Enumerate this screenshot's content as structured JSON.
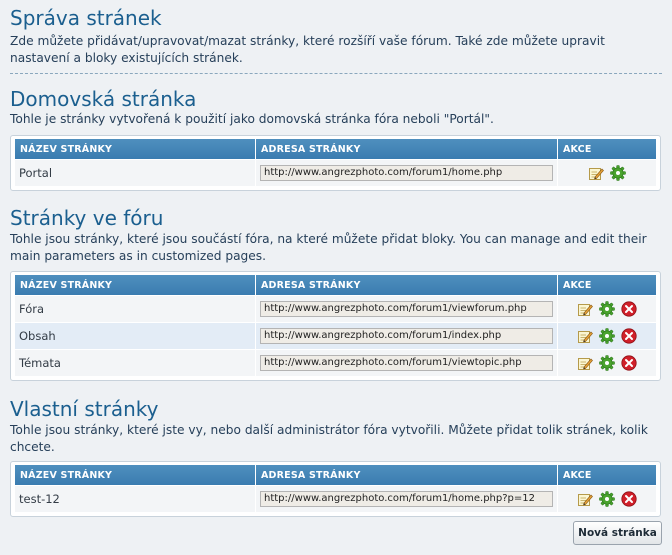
{
  "page": {
    "title": "Správa stránek",
    "intro": "Zde můžete přidávat/upravovat/mazat stránky, které rozšíří vaše fórum. Také zde můžete upravit nastavení a bloky existujících stránek."
  },
  "columns": {
    "name": "NÁZEV STRÁNKY",
    "address": "ADRESA STRÁNKY",
    "actions": "AKCE"
  },
  "home": {
    "title": "Domovská stránka",
    "desc": "Tohle je stránky vytvořená k použití jako domovská stránka fóra neboli \"Portál\".",
    "rows": [
      {
        "name": "Portal",
        "url": "http://www.angrezphoto.com/forum1/home.php"
      }
    ]
  },
  "forum": {
    "title": "Stránky ve fóru",
    "desc": "Tohle jsou stránky, které jsou součástí fóra, na které můžete přidat bloky. You can manage and edit their main parameters as in customized pages.",
    "rows": [
      {
        "name": "Fóra",
        "url": "http://www.angrezphoto.com/forum1/viewforum.php"
      },
      {
        "name": "Obsah",
        "url": "http://www.angrezphoto.com/forum1/index.php"
      },
      {
        "name": "Témata",
        "url": "http://www.angrezphoto.com/forum1/viewtopic.php"
      }
    ]
  },
  "custom": {
    "title": "Vlastní stránky",
    "desc": "Tohle jsou stránky, které jste vy, nebo další administrátor fóra vytvořili. Můžete přidat tolik stránek, kolik chcete.",
    "rows": [
      {
        "name": "test-12",
        "url": "http://www.angrezphoto.com/forum1/home.php?p=12"
      }
    ]
  },
  "buttons": {
    "new_page": "Nová stránka"
  },
  "icons": {
    "edit": "edit-icon",
    "settings": "gear-icon",
    "delete": "delete-icon"
  },
  "colors": {
    "header": "#3a7cb0",
    "title": "#1b5f8f",
    "delete": "#d0202a",
    "gear": "#4aa32e"
  }
}
